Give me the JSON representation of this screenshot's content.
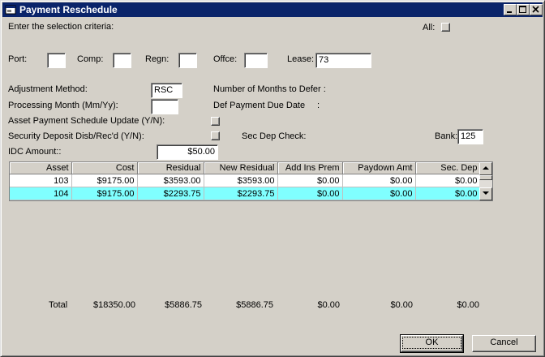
{
  "window": {
    "title": "Payment Reschedule"
  },
  "criteria": {
    "heading": "Enter the selection criteria:",
    "all_label": "All:",
    "port_label": "Port:",
    "port_value": "",
    "comp_label": "Comp:",
    "comp_value": "",
    "regn_label": "Regn:",
    "regn_value": "",
    "offce_label": "Offce:",
    "offce_value": "",
    "lease_label": "Lease:",
    "lease_value": "73"
  },
  "form": {
    "adjustment_method_label": "Adjustment Method:",
    "adjustment_method_value": "RSC",
    "processing_month_label": "Processing Month (Mm/Yy):",
    "processing_month_value": "",
    "asset_payment_label": "Asset Payment Schedule Update (Y/N):",
    "security_deposit_label": "Security Deposit Disb/Rec'd (Y/N):",
    "idc_amount_label": "IDC Amount::",
    "idc_amount_value": "$50.00",
    "months_to_defer_label": "Number of Months to Defer :",
    "def_payment_label": "Def Payment Due Date",
    "def_payment_colon": ":",
    "sec_dep_check_label": "Sec Dep Check:",
    "bank_label": "Bank:",
    "bank_value": "125"
  },
  "grid": {
    "columns": [
      "Asset",
      "Cost",
      "Residual",
      "New Residual",
      "Add Ins Prem",
      "Paydown Amt",
      "Sec. Dep"
    ],
    "rows": [
      [
        "103",
        "$9175.00",
        "$3593.00",
        "$3593.00",
        "$0.00",
        "$0.00",
        "$0.00"
      ],
      [
        "104",
        "$9175.00",
        "$2293.75",
        "$2293.75",
        "$0.00",
        "$0.00",
        "$0.00"
      ]
    ],
    "selected_row": 1,
    "selected_color": "#80ffff"
  },
  "totals": {
    "label": "Total",
    "cost": "$18350.00",
    "residual": "$5886.75",
    "new_residual": "$5886.75",
    "add_ins_prem": "$0.00",
    "paydown_amt": "$0.00",
    "sec_dep": "$0.00"
  },
  "buttons": {
    "ok": "OK",
    "cancel": "Cancel"
  },
  "icons": {
    "app": "window-icon",
    "minimize": "minimize-icon",
    "maximize": "maximize-icon",
    "close": "close-icon"
  }
}
